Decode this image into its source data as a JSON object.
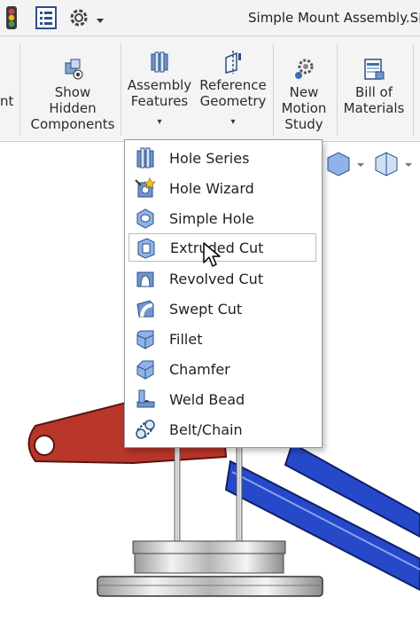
{
  "window": {
    "title": "Simple Mount Assembly.SL"
  },
  "ribbon": {
    "cut_label": "nt",
    "show_hidden": {
      "line1": "Show",
      "line2": "Hidden",
      "line3": "Components"
    },
    "assembly_features": {
      "line1": "Assembly",
      "line2": "Features"
    },
    "reference_geometry": {
      "line1": "Reference",
      "line2": "Geometry"
    },
    "motion_study": {
      "line1": "New",
      "line2": "Motion",
      "line3": "Study"
    },
    "bill_of_materials": {
      "line1": "Bill of",
      "line2": "Materials"
    },
    "caret": "▾"
  },
  "menu": {
    "items": [
      {
        "label": "Hole Series",
        "icon": "hole-series-icon"
      },
      {
        "label": "Hole Wizard",
        "icon": "hole-wizard-icon"
      },
      {
        "label": "Simple Hole",
        "icon": "simple-hole-icon"
      },
      {
        "label": "Extruded Cut",
        "icon": "extruded-cut-icon"
      },
      {
        "label": "Revolved Cut",
        "icon": "revolved-cut-icon"
      },
      {
        "label": "Swept Cut",
        "icon": "swept-cut-icon"
      },
      {
        "label": "Fillet",
        "icon": "fillet-icon"
      },
      {
        "label": "Chamfer",
        "icon": "chamfer-icon"
      },
      {
        "label": "Weld Bead",
        "icon": "weld-bead-icon"
      },
      {
        "label": "Belt/Chain",
        "icon": "belt-chain-icon"
      }
    ],
    "hovered": "Extruded Cut"
  },
  "colors": {
    "arm_red": "#b8362a",
    "frame_blue": "#2649c9",
    "icon_blue": "#3b6fb0",
    "ribbon_bg": "#f4f4f4"
  }
}
